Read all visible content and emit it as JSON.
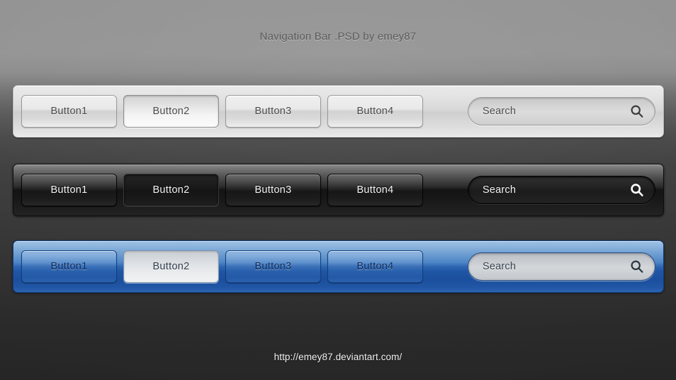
{
  "page": {
    "title": "Navigation Bar .PSD by emey87",
    "footer_url": "http://emey87.deviantart.com/"
  },
  "colors": {
    "background_top": "#939393",
    "background_bottom": "#2a2a2a",
    "title_text": "#5b5b5b",
    "footer_text": "#f2f2f2",
    "light_bar": "#dcdcdc",
    "dark_bar": "#1a1a1a",
    "blue_bar": "#2e66b2",
    "blue_bar_top": "#9ec2e4",
    "blue_bar_bottom": "#1b4f9d"
  },
  "bars": [
    {
      "theme": "light",
      "name": "light-navigation-bar",
      "buttons": [
        {
          "label": "Button1",
          "active": false
        },
        {
          "label": "Button2",
          "active": true
        },
        {
          "label": "Button3",
          "active": false
        },
        {
          "label": "Button4",
          "active": false
        }
      ],
      "search": {
        "value": "",
        "placeholder": "Search",
        "icon": "search-icon"
      }
    },
    {
      "theme": "dark",
      "name": "dark-navigation-bar",
      "buttons": [
        {
          "label": "Button1",
          "active": false
        },
        {
          "label": "Button2",
          "active": true
        },
        {
          "label": "Button3",
          "active": false
        },
        {
          "label": "Button4",
          "active": false
        }
      ],
      "search": {
        "value": "",
        "placeholder": "Search",
        "icon": "search-icon"
      }
    },
    {
      "theme": "blue",
      "name": "blue-navigation-bar",
      "buttons": [
        {
          "label": "Button1",
          "active": false
        },
        {
          "label": "Button2",
          "active": true
        },
        {
          "label": "Button3",
          "active": false
        },
        {
          "label": "Button4",
          "active": false
        }
      ],
      "search": {
        "value": "",
        "placeholder": "Search",
        "icon": "search-icon"
      }
    }
  ]
}
